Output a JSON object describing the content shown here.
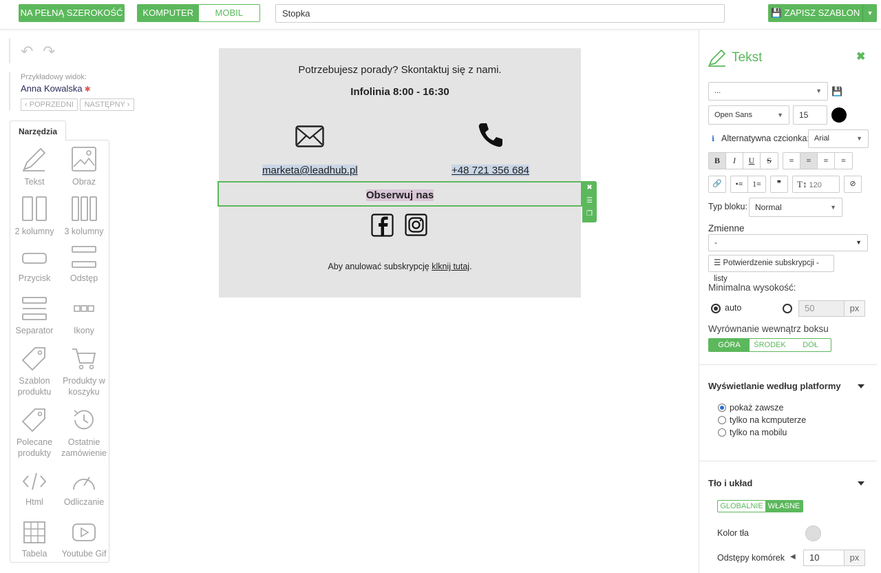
{
  "topbar": {
    "full_width_label": "NA PEŁNĄ SZEROKOŚĆ",
    "view_desktop": "KOMPUTER",
    "view_mobile": "MOBIL",
    "template_name": "Stopka",
    "save_label": "ZAPISZ SZABLON"
  },
  "preview": {
    "label": "Przykładowy widok:",
    "name": "Anna Kowalska",
    "prev": "POPRZEDNI",
    "next": "NASTĘPNY"
  },
  "tools": {
    "tab": "Narzędzia",
    "items": [
      {
        "label": "Tekst",
        "icon": "pencil-icon"
      },
      {
        "label": "Obraz",
        "icon": "image-icon"
      },
      {
        "label": "2 kolumny",
        "icon": "two-columns-icon"
      },
      {
        "label": "3 kolumny",
        "icon": "three-columns-icon"
      },
      {
        "label": "Przycisk",
        "icon": "button-icon"
      },
      {
        "label": "Odstęp",
        "icon": "spacer-icon"
      },
      {
        "label": "Separator",
        "icon": "separator-icon"
      },
      {
        "label": "Ikony",
        "icon": "icons-icon"
      },
      {
        "label": "Szablon produktu",
        "icon": "tag-icon"
      },
      {
        "label": "Produkty w koszyku",
        "icon": "cart-icon"
      },
      {
        "label": "Polecane produkty",
        "icon": "tag-icon"
      },
      {
        "label": "Ostatnie zamówienie",
        "icon": "history-icon"
      },
      {
        "label": "Html",
        "icon": "code-icon"
      },
      {
        "label": "Odliczanie",
        "icon": "gauge-icon"
      },
      {
        "label": "Tabela",
        "icon": "table-icon"
      },
      {
        "label": "Youtube Gif",
        "icon": "youtube-icon"
      }
    ]
  },
  "email": {
    "line1": "Potrzebujesz porady? Skontaktuj się z nami.",
    "line2": "Infolinia 8:00 - 16:30",
    "email_link": "marketa@leadhub.pl",
    "phone_link": "+48 721 356 684",
    "follow": "Obserwuj nas",
    "unsub_text": "Aby anulować subskrypcję ",
    "unsub_link": "klknij tutaj",
    "unsub_end": "."
  },
  "panel": {
    "title": "Tekst",
    "style_select": "...",
    "font": "Open Sans",
    "font_size": "15",
    "alt_font_label": "Alternatywna czcionka:",
    "alt_font": "Arial",
    "line_height": "120",
    "block_type_label": "Typ bloku:",
    "block_type": "Normal",
    "variables_label": "Zmienne",
    "variables_value": "-",
    "confirm_button": "Potwierdzenie subskrypcji - listy",
    "min_height_label": "Minimalna wysokość:",
    "auto_label": "auto",
    "min_height_value": "50",
    "px": "px",
    "align_label": "Wyrównanie wewnątrz boksu",
    "align_options": [
      "GÓRA",
      "ŚRODEK",
      "DÓŁ"
    ],
    "platform_title": "Wyświetlanie według platformy",
    "platform_options": [
      "pokaż zawsze",
      "tylko na kcmputerze",
      "tylko na mobilu"
    ],
    "bg_title": "Tło i układ",
    "bg_modes": [
      "GLOBALNIE",
      "WŁASNE"
    ],
    "bg_color_label": "Kolor tła",
    "cell_spacing_label": "Odstępy komórek",
    "cell_spacing_value": "10"
  },
  "colors": {
    "accent": "#5cb85c",
    "email_bg": "#e4e4e4"
  }
}
